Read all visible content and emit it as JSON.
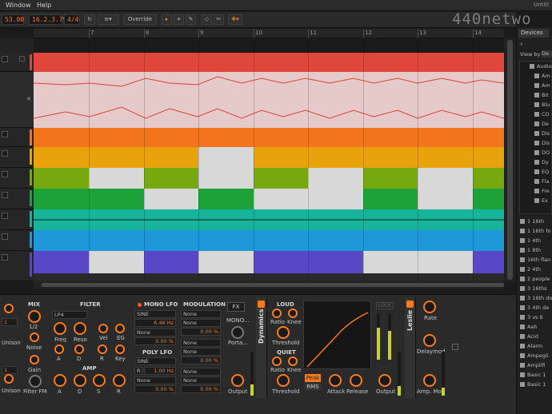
{
  "menu": {
    "items": [
      "Window",
      "Help"
    ],
    "app_title": "Untitl"
  },
  "toolbar": {
    "tempo": "53.00",
    "position": "16.2.3.79",
    "signature": "4/4",
    "override_label": "Override"
  },
  "watermark": "440netwo",
  "ruler": {
    "labels": [
      "7",
      "8",
      "9",
      "10",
      "11",
      "12",
      "13",
      "14"
    ]
  },
  "browser": {
    "tab_label": "Devices",
    "view_by_label": "View by",
    "view_by_value": "De",
    "tree_items": [
      "Audio",
      "Am",
      "Am",
      "Bit",
      "Blu",
      "CO",
      "De",
      "Dis",
      "Dis",
      "DO",
      "Dy",
      "EQ",
      "Fla",
      "Fre",
      "Ex"
    ],
    "preset_items": [
      "1 16th",
      "1 16th fo",
      "1 4th",
      "1 8th",
      "16th flan",
      "2 4th",
      "2 people",
      "3 16ths",
      "3 16th do",
      "3 4th de",
      "3 vs 6",
      "Aah",
      "Acid",
      "Alarm",
      "Ampegli",
      "Amplifi",
      "Basic 1",
      "Basic 1"
    ]
  },
  "synth": {
    "mix_label": "MIX",
    "filter_label": "FILTER",
    "filter_type": "LP4",
    "mono_lfo_label": "MONO LFO",
    "modulation_label": "MODULATION",
    "fx_label": "FX",
    "mono_label": "MONO...",
    "unison_label": "Unison",
    "unison2_label": "Unison",
    "half_label": "1/2",
    "noise_label": "Noise",
    "gain_label": "Gain",
    "filter_fm_label": "Filter FM",
    "freq_label": "Freq",
    "reso_label": "Reso",
    "vel_label": "Vel",
    "eg_label": "EG",
    "a_label": "A",
    "d_label": "D",
    "r_label": "R",
    "key_label": "Key",
    "amp_label": "AMP",
    "amp_a": "A",
    "amp_d": "D",
    "amp_s": "S",
    "amp_r": "R",
    "lfo_wave": "SINE",
    "lfo_rate": "6.46 Hz",
    "lfo_none1": "None",
    "lfo_pct1": "0.00 %",
    "poly_lfo_label": "POLY LFO",
    "poly_wave": "SINE",
    "poly_r": "R",
    "poly_rate": "1.00 Hz",
    "poly_none": "None",
    "poly_pct": "0.00 %",
    "mod_none": "None",
    "mod_pct": "0.00 %",
    "porta_label": "Porta...",
    "output_label": "Output",
    "small_val1": "1",
    "small_val2": "1"
  },
  "dynamics": {
    "title": "Dynamics",
    "loud_label": "LOUD",
    "ratio_label": "Ratio",
    "knee_label": "Knee",
    "threshold_label": "Threshold",
    "quiet_label": "QUIET",
    "ratio2_label": "Ratio",
    "knee2_label": "Knee",
    "threshold2_label": "Threshold",
    "peak_label": "Peak",
    "rms_label": "RMS",
    "attack_label": "Attack",
    "release_label": "Release",
    "lock_label": "LOCK",
    "output_label": "Output"
  },
  "leslie": {
    "title": "Leslie",
    "rate_label": "Rate",
    "delaymod_label": "Delaymod",
    "ampmod_label": "Amp. Mod"
  },
  "colors": {
    "accent": "#ff7a1a",
    "red": "#e0463a",
    "orange": "#f2741c",
    "yellow": "#e8a20c",
    "olive": "#76a810",
    "green": "#1da23a",
    "teal": "#17b39a",
    "blue": "#1e98d8",
    "purple": "#5848c8"
  }
}
